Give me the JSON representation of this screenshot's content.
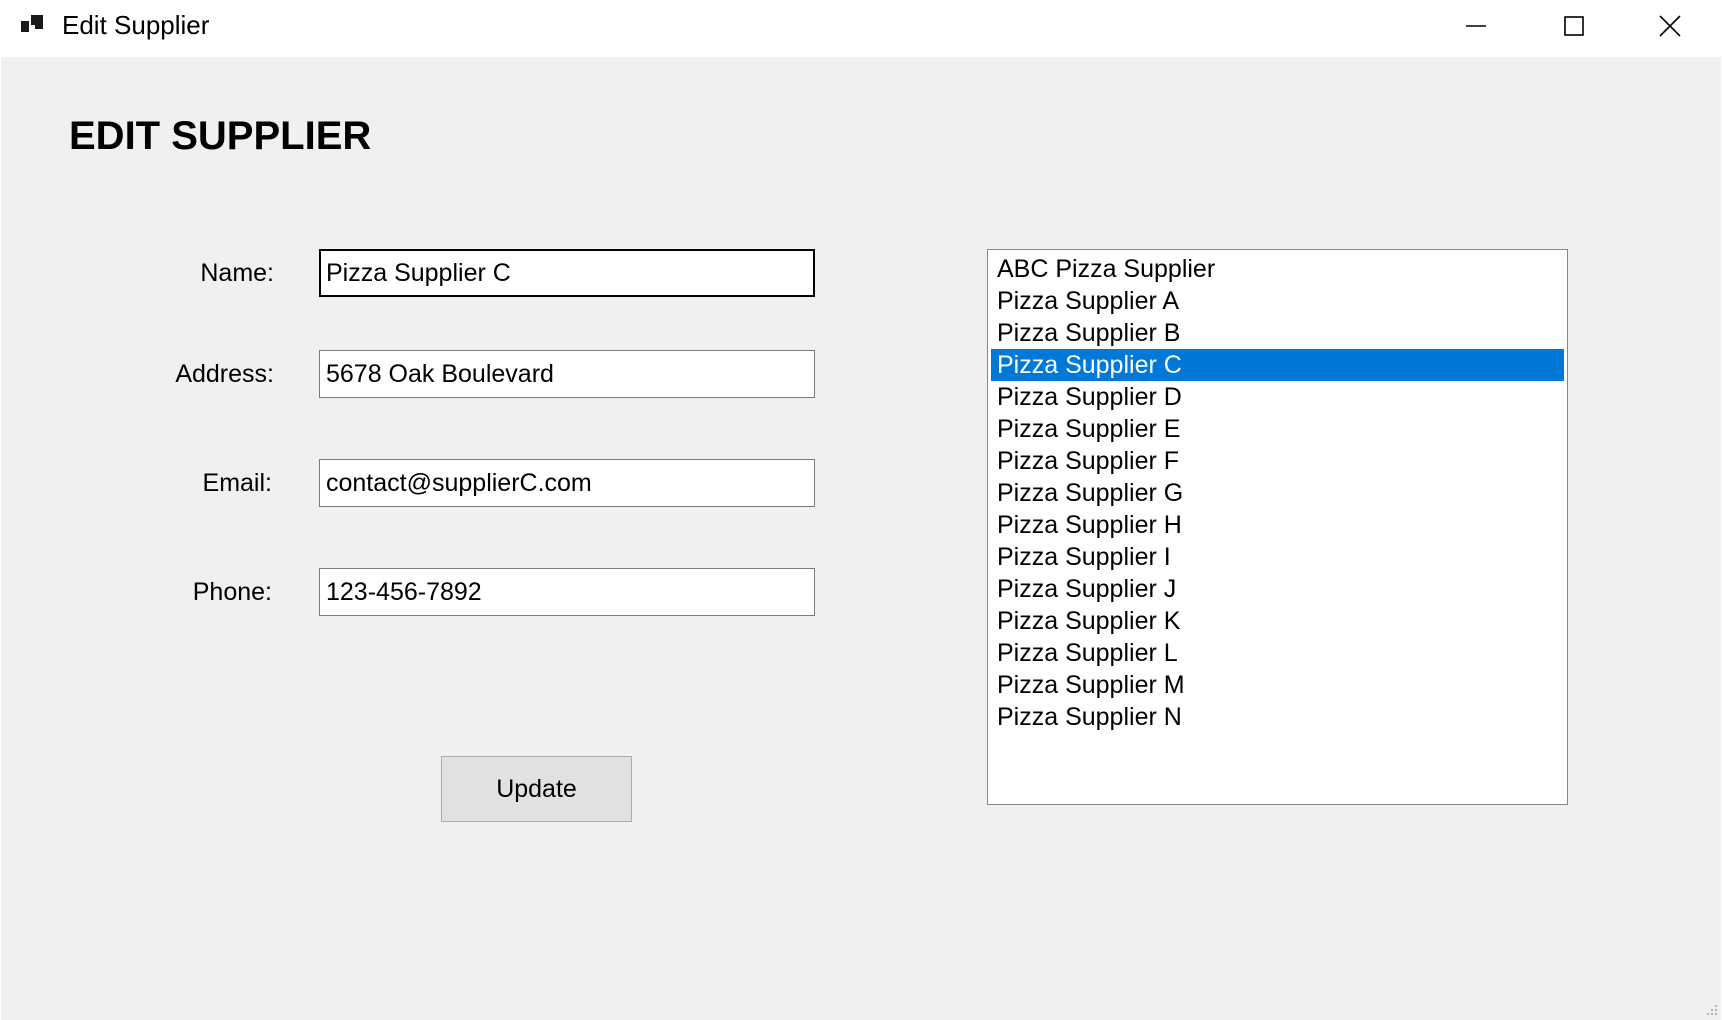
{
  "window": {
    "title": "Edit Supplier",
    "controls": {
      "minimize": "minimize-icon",
      "maximize": "maximize-icon",
      "close": "close-icon"
    }
  },
  "form": {
    "heading": "EDIT SUPPLIER",
    "fields": {
      "name": {
        "label": "Name:",
        "value": "Pizza Supplier C"
      },
      "address": {
        "label": "Address:",
        "value": "5678 Oak Boulevard"
      },
      "email": {
        "label": "Email:",
        "value": "contact@supplierC.com"
      },
      "phone": {
        "label": "Phone:",
        "value": "123-456-7892"
      }
    },
    "update_label": "Update"
  },
  "suppliers": {
    "items": [
      "ABC Pizza Supplier",
      "Pizza Supplier A",
      "Pizza Supplier B",
      "Pizza Supplier C",
      "Pizza Supplier D",
      "Pizza Supplier E",
      "Pizza Supplier F",
      "Pizza Supplier G",
      "Pizza Supplier H",
      "Pizza Supplier I",
      "Pizza Supplier J",
      "Pizza Supplier K",
      "Pizza Supplier L",
      "Pizza Supplier M",
      "Pizza Supplier N"
    ],
    "selected_index": 3
  },
  "colors": {
    "selection": "#0078d7",
    "client_background": "#f0f0f0",
    "button_face": "#e1e1e1"
  }
}
